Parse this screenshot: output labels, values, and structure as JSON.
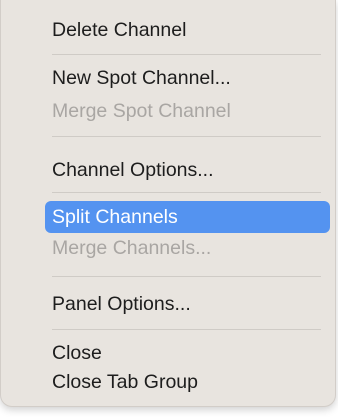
{
  "menu": {
    "items": [
      {
        "label": "Delete Channel",
        "enabled": true
      },
      {
        "label": "New Spot Channel...",
        "enabled": true
      },
      {
        "label": "Merge Spot Channel",
        "enabled": false
      },
      {
        "label": "Channel Options...",
        "enabled": true
      },
      {
        "label": "Split Channels",
        "enabled": true,
        "highlighted": true
      },
      {
        "label": "Merge Channels...",
        "enabled": false
      },
      {
        "label": "Panel Options...",
        "enabled": true
      },
      {
        "label": "Close",
        "enabled": true
      },
      {
        "label": "Close Tab Group",
        "enabled": true
      }
    ],
    "colors": {
      "highlight": "#5493f0"
    }
  }
}
